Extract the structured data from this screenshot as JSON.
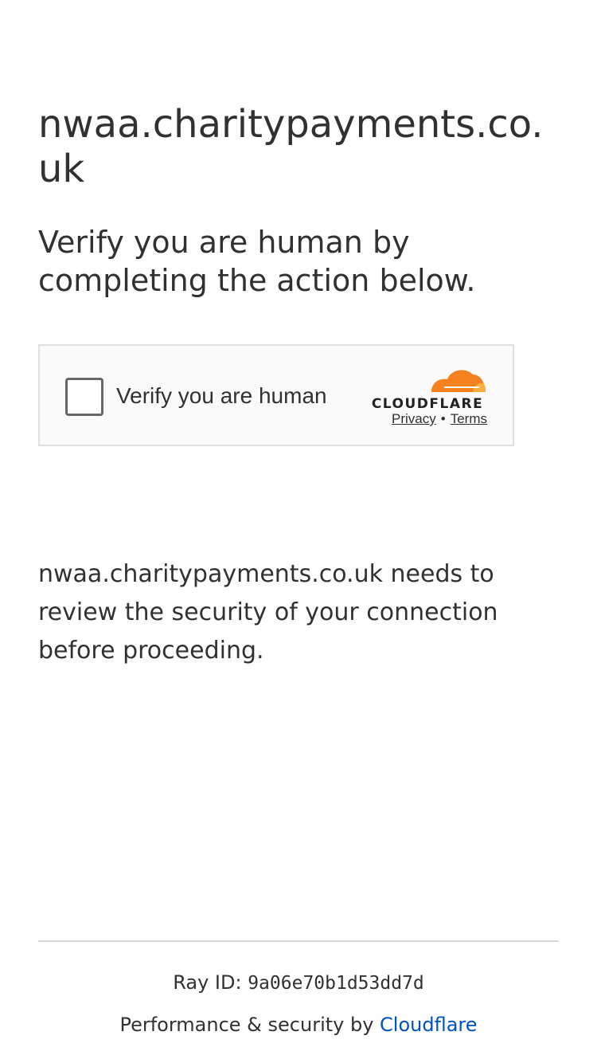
{
  "page": {
    "site_title": "nwaa.charitypayments.co.uk",
    "subtitle": "Verify you are human by completing the action below."
  },
  "widget": {
    "checkbox_label": "Verify you are human",
    "brand_text": "CLOUDFLARE",
    "privacy_label": "Privacy",
    "separator": "•",
    "terms_label": "Terms"
  },
  "description": "nwaa.charitypayments.co.uk needs to review the security of your connection before proceeding.",
  "footer": {
    "ray_prefix": "Ray ID: ",
    "ray_id": "9a06e70b1d53dd7d",
    "perf_prefix": "Performance & security by ",
    "perf_link": "Cloudflare"
  },
  "colors": {
    "text": "#313131",
    "link": "#0051c3",
    "cloudflare_orange": "#f6821f",
    "cloudflare_light_orange": "#fbad41"
  }
}
